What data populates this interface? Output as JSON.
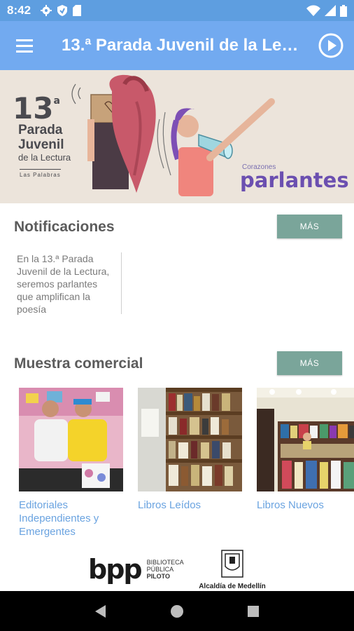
{
  "status_bar": {
    "time": "8:42",
    "icons": [
      "settings-icon",
      "shield-icon",
      "sd-card-icon",
      "wifi-icon",
      "signal-icon",
      "battery-icon"
    ]
  },
  "app_bar": {
    "title": "13.ª Parada Juvenil de la Lectura",
    "menu_icon": "hamburger-menu-icon",
    "play_icon": "play-circle-icon"
  },
  "banner": {
    "number": "13",
    "ordinal": "a",
    "line1": "Parada",
    "line2": "Juvenil",
    "line3": "de la Lectura",
    "logo_text": "Las Palabras",
    "tagline_small": "Corazones",
    "tagline_big": "parlantes"
  },
  "notifications": {
    "title": "Notificaciones",
    "more_label": "MÁS",
    "items": [
      {
        "text": "En la 13.ª Parada Juvenil de la Lectura, seremos parlantes que amplifican la poesía"
      }
    ]
  },
  "commercial": {
    "title": "Muestra comercial",
    "more_label": "MÁS",
    "items": [
      {
        "caption": "Editoriales Independientes y Emergentes"
      },
      {
        "caption": "Libros Leídos"
      },
      {
        "caption": "Libros Nuevos"
      }
    ]
  },
  "footer": {
    "bpp_logo": "bpp",
    "bpp_line1": "BIBLIOTECA",
    "bpp_line2": "PÚBLICA",
    "bpp_line3": "PILOTO",
    "alcaldia": "Alcaldía de Medellín"
  },
  "colors": {
    "status_bar": "#5e9ee0",
    "app_bar": "#72aaf0",
    "more_button": "#7aa59a",
    "link_text": "#6aa3e0"
  }
}
